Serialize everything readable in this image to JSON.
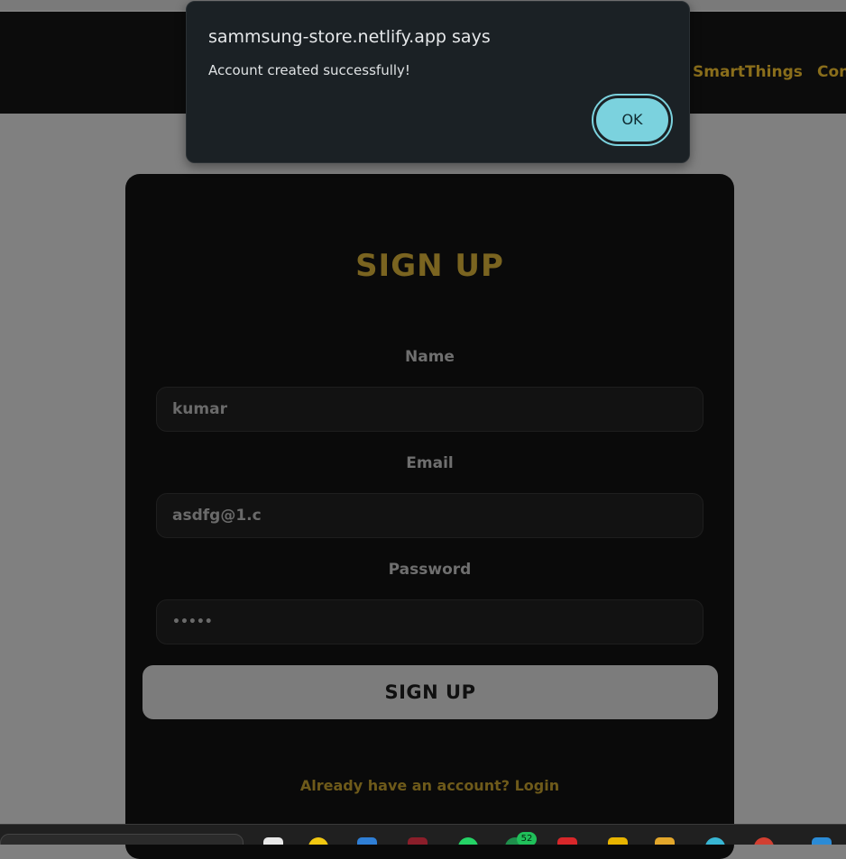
{
  "nav": {
    "links": [
      "SmartThings",
      "Con"
    ]
  },
  "signup": {
    "title": "SIGN UP",
    "name_label": "Name",
    "name_value": "kumar",
    "email_label": "Email",
    "email_value": "asdfg@1.c",
    "password_label": "Password",
    "password_value": "•••••",
    "submit_label": "SIGN UP",
    "login_link": "Already have an account? Login"
  },
  "dialog": {
    "title": "sammsung-store.netlify.app says",
    "message": "Account created successfully!",
    "ok_label": "OK"
  },
  "taskbar": {
    "badge": "52",
    "icons": [
      "notepad-icon",
      "smiley-icon",
      "store-icon",
      "app-icon",
      "whatsapp-icon",
      "chat-icon",
      "game-icon",
      "sticky-icon",
      "folder-icon",
      "browser-icon",
      "chrome-icon",
      "vscode-icon"
    ]
  },
  "colors": {
    "accent_gold": "#8a6e1b",
    "card_bg": "#0a0a0a",
    "dialog_bg": "#1b2125",
    "ok_button": "#7bd2de"
  }
}
